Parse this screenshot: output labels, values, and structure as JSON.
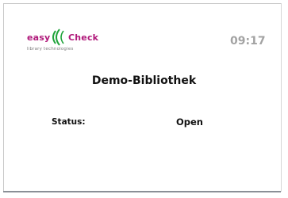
{
  "brand": {
    "word_easy": "easy",
    "word_check": "Check",
    "tagline": "library technologies",
    "primary_color": "#b0187a",
    "accent_color": "#1fa33a"
  },
  "header": {
    "time": "09:17"
  },
  "main": {
    "title": "Demo-Bibliothek",
    "status_label": "Status:",
    "status_value": "Open"
  }
}
